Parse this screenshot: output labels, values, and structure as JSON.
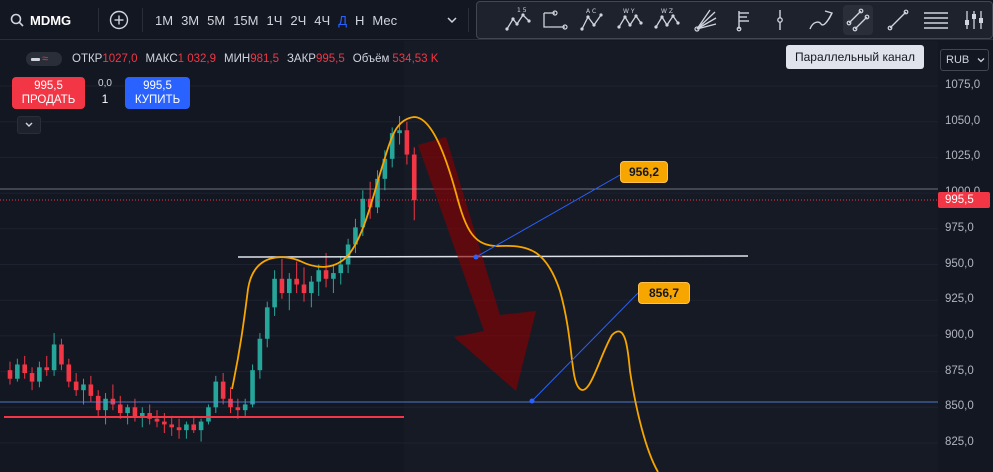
{
  "symbol": {
    "ticker": "MDMG",
    "search_icon": "search-icon"
  },
  "intervals": [
    {
      "label": "1М",
      "active": false
    },
    {
      "label": "3М",
      "active": false
    },
    {
      "label": "5М",
      "active": false
    },
    {
      "label": "15М",
      "active": false
    },
    {
      "label": "1Ч",
      "active": false
    },
    {
      "label": "2Ч",
      "active": false
    },
    {
      "label": "4Ч",
      "active": false
    },
    {
      "label": "Д",
      "active": true
    },
    {
      "label": "Н",
      "active": false
    },
    {
      "label": "Мес",
      "active": false
    }
  ],
  "drawing_tools": [
    {
      "icon": "elliott-impulse-icon",
      "label": "1 5"
    },
    {
      "icon": "xabcd-pattern-icon",
      "label": ""
    },
    {
      "icon": "abcd-pattern-icon",
      "label": "A C"
    },
    {
      "icon": "wave-wy-icon",
      "label": "W Y"
    },
    {
      "icon": "wave-wz-icon",
      "label": "W Z"
    },
    {
      "icon": "fib-fan-icon",
      "label": ""
    },
    {
      "icon": "flag-icon",
      "label": ""
    },
    {
      "icon": "vertical-line-icon",
      "label": ""
    },
    {
      "icon": "brush-icon",
      "label": ""
    },
    {
      "icon": "parallel-channel-icon",
      "label": "",
      "active": true
    },
    {
      "icon": "trend-line-icon",
      "label": ""
    },
    {
      "icon": "horizontal-lines-icon",
      "label": ""
    },
    {
      "icon": "sliders-icon",
      "label": ""
    }
  ],
  "tooltip": "Параллельный канал",
  "ohlc": {
    "open_label": "ОТКР",
    "open": "1027,0",
    "high_label": "МАКС",
    "high": "1 032,9",
    "low_label": "МИН",
    "low": "981,5",
    "close_label": "ЗАКР",
    "close": "995,5",
    "volume_label": "Объём",
    "volume": "534,53 K"
  },
  "trade": {
    "sell_price": "995,5",
    "sell_label": "ПРОДАТЬ",
    "spread": "0,0",
    "quantity": "1",
    "buy_price": "995,5",
    "buy_label": "КУПИТЬ"
  },
  "price_axis": {
    "currency": "RUB",
    "ticks": [
      "1075,0",
      "1050,0",
      "1025,0",
      "1000,0",
      "975,0",
      "950,0",
      "925,0",
      "900,0",
      "875,0",
      "850,0",
      "825,0"
    ],
    "current_price": "995,5",
    "current_price_color": "#f23645"
  },
  "annotations": {
    "callout_1": "956,2",
    "callout_2": "856,7"
  },
  "colors": {
    "background": "#131722",
    "up": "#26a69a",
    "down": "#f23645",
    "accent": "#2962ff",
    "drawing": "#f7a600",
    "arrow": "#8b0000"
  },
  "chart_data": {
    "type": "candlestick",
    "y_range": [
      815,
      1090
    ],
    "candles": [
      [
        876,
        882,
        866,
        870
      ],
      [
        870,
        884,
        868,
        880
      ],
      [
        880,
        886,
        870,
        874
      ],
      [
        874,
        878,
        862,
        868
      ],
      [
        868,
        882,
        864,
        878
      ],
      [
        878,
        886,
        872,
        876
      ],
      [
        876,
        902,
        872,
        894
      ],
      [
        894,
        898,
        876,
        880
      ],
      [
        880,
        884,
        864,
        868
      ],
      [
        868,
        874,
        858,
        862
      ],
      [
        862,
        870,
        852,
        866
      ],
      [
        866,
        872,
        854,
        858
      ],
      [
        858,
        862,
        844,
        848
      ],
      [
        848,
        860,
        838,
        856
      ],
      [
        856,
        866,
        848,
        852
      ],
      [
        852,
        858,
        842,
        846
      ],
      [
        846,
        852,
        838,
        850
      ],
      [
        850,
        856,
        840,
        843
      ],
      [
        843,
        850,
        836,
        846
      ],
      [
        846,
        852,
        838,
        842
      ],
      [
        842,
        848,
        836,
        840
      ],
      [
        840,
        846,
        832,
        838
      ],
      [
        838,
        844,
        830,
        836
      ],
      [
        836,
        842,
        828,
        834
      ],
      [
        834,
        840,
        828,
        838
      ],
      [
        838,
        844,
        832,
        834
      ],
      [
        834,
        842,
        826,
        840
      ],
      [
        840,
        852,
        838,
        850
      ],
      [
        850,
        872,
        846,
        868
      ],
      [
        868,
        874,
        852,
        856
      ],
      [
        856,
        864,
        846,
        850
      ],
      [
        850,
        856,
        842,
        848
      ],
      [
        848,
        856,
        844,
        852
      ],
      [
        852,
        880,
        850,
        876
      ],
      [
        876,
        902,
        870,
        898
      ],
      [
        898,
        924,
        892,
        920
      ],
      [
        920,
        946,
        914,
        940
      ],
      [
        940,
        954,
        926,
        930
      ],
      [
        930,
        944,
        918,
        940
      ],
      [
        940,
        952,
        930,
        936
      ],
      [
        936,
        948,
        924,
        930
      ],
      [
        930,
        942,
        920,
        938
      ],
      [
        938,
        950,
        928,
        946
      ],
      [
        946,
        958,
        934,
        940
      ],
      [
        940,
        950,
        930,
        944
      ],
      [
        944,
        956,
        936,
        950
      ],
      [
        950,
        968,
        944,
        964
      ],
      [
        964,
        982,
        958,
        976
      ],
      [
        976,
        1002,
        970,
        996
      ],
      [
        996,
        1008,
        982,
        990
      ],
      [
        990,
        1016,
        986,
        1010
      ],
      [
        1010,
        1030,
        1002,
        1024
      ],
      [
        1024,
        1046,
        1018,
        1042
      ],
      [
        1042,
        1054,
        1034,
        1044
      ],
      [
        1044,
        1050,
        1020,
        1027
      ],
      [
        1027,
        1032,
        981,
        995
      ]
    ]
  }
}
